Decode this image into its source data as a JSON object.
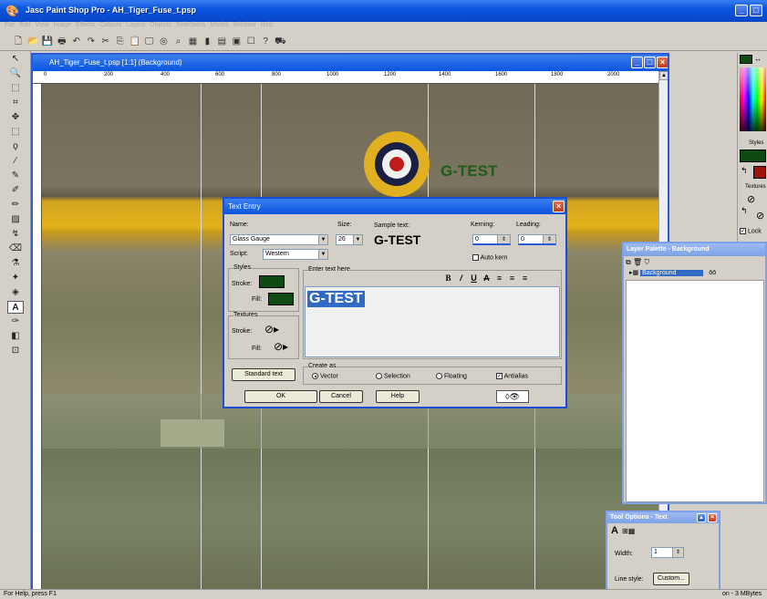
{
  "app": {
    "title": "Jasc Paint Shop Pro - AH_Tiger_Fuse_t.psp"
  },
  "menu": [
    "File",
    "Edit",
    "View",
    "Image",
    "Effects",
    "Colours",
    "Layers",
    "Objects",
    "Selections",
    "Masks",
    "Window",
    "Help"
  ],
  "document": {
    "title": "AH_Tiger_Fuse_t.psp [1:1] (Background)",
    "ruler_ticks": [
      "0",
      "200",
      "400",
      "600",
      "800",
      "1000",
      "1200",
      "1400",
      "1600",
      "1800",
      "2000"
    ],
    "canvas_text": "G-TEST"
  },
  "dialog": {
    "title": "Text Entry",
    "name_label": "Name:",
    "name_value": "Glass Gauge",
    "size_label": "Size:",
    "size_value": "26",
    "sample_label": "Sample text:",
    "sample_text": "G-TEST",
    "kerning_label": "Kerning:",
    "kerning_value": "0",
    "leading_label": "Leading:",
    "leading_value": "0",
    "script_label": "Script:",
    "script_value": "Western",
    "auto_kern_label": "Auto kern",
    "styles_label": "Styles",
    "stroke_label": "Stroke:",
    "fill_label": "Fill:",
    "textures_label": "Textures",
    "enter_text_label": "Enter text here",
    "text_value": "G-TEST",
    "create_as_label": "Create as",
    "vector_label": "Vector",
    "selection_label": "Selection",
    "floating_label": "Floating",
    "antialias_label": "Antialias",
    "standard_text_label": "Standard text",
    "ok_label": "OK",
    "cancel_label": "Cancel",
    "help_label": "Help",
    "style_color": "#0e4a12"
  },
  "styles_panel": {
    "styles_label": "Styles",
    "textures_label": "Textures",
    "lock_label": "Lock"
  },
  "layer_palette": {
    "title": "Layer Palette - Background",
    "layers": [
      {
        "name": "Background",
        "meta": "ōō"
      }
    ]
  },
  "tool_options": {
    "title": "Tool Options - Text",
    "width_label": "Width:",
    "width_value": "1",
    "line_style_label": "Line style:",
    "custom_label": "Custom..."
  },
  "status": {
    "help_text": "For Help, press F1",
    "memory_text": "on - 3 MBytes"
  }
}
